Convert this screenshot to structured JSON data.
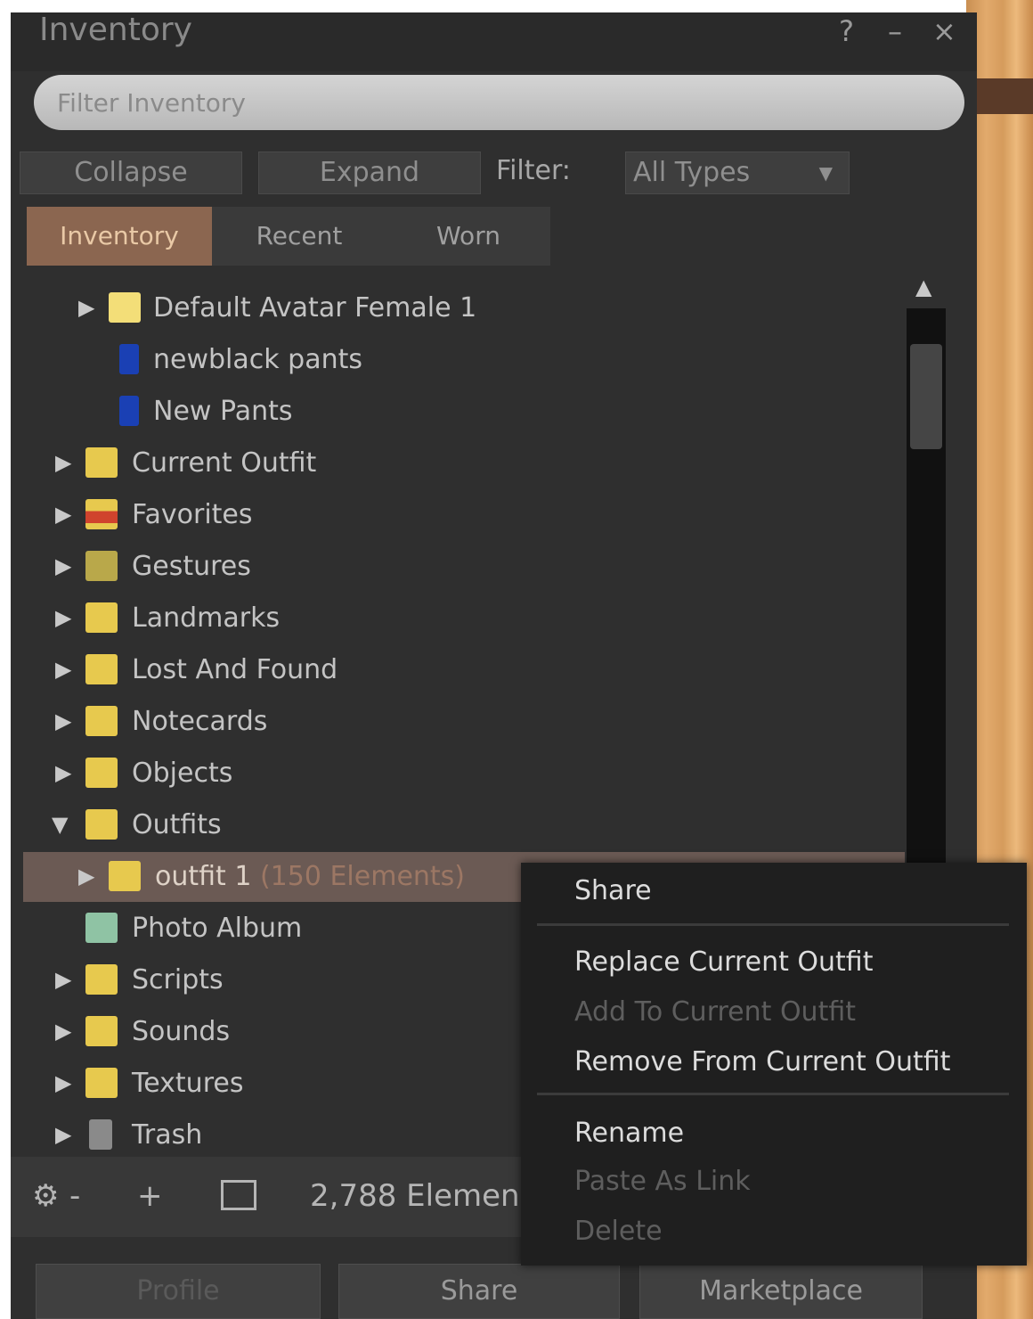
{
  "window": {
    "title": "Inventory",
    "controls": [
      "?",
      "–",
      "×"
    ]
  },
  "filter": {
    "placeholder": "Filter Inventory"
  },
  "toolbar": {
    "collapse_label": "Collapse",
    "expand_label": "Expand",
    "filter_label": "Filter:",
    "type_select": "All Types"
  },
  "tabs": [
    "Inventory",
    "Recent",
    "Worn"
  ],
  "tree": {
    "items": [
      {
        "label": "Default Avatar Female 1",
        "icon": "folder-icon",
        "expandable": true
      },
      {
        "label": "newblack pants",
        "icon": "pants-icon",
        "expandable": false
      },
      {
        "label": "New Pants",
        "icon": "pants-icon",
        "expandable": false
      },
      {
        "label": "Current Outfit",
        "icon": "outfit-folder-icon",
        "expandable": true
      },
      {
        "label": "Favorites",
        "icon": "favorites-folder-icon",
        "expandable": true
      },
      {
        "label": "Gestures",
        "icon": "gestures-folder-icon",
        "expandable": true
      },
      {
        "label": "Landmarks",
        "icon": "landmarks-folder-icon",
        "expandable": true
      },
      {
        "label": "Lost And Found",
        "icon": "lost-found-folder-icon",
        "expandable": true
      },
      {
        "label": "Notecards",
        "icon": "notecards-folder-icon",
        "expandable": true
      },
      {
        "label": "Objects",
        "icon": "objects-folder-icon",
        "expandable": true
      },
      {
        "label": "Outfits",
        "icon": "outfits-folder-icon",
        "expandable": true,
        "expanded": true
      },
      {
        "label": "outfit 1",
        "count": "(150 Elements)",
        "icon": "outfit-folder-icon",
        "expandable": true,
        "selected": true
      },
      {
        "label": "Photo Album",
        "icon": "photo-album-folder-icon",
        "expandable": false
      },
      {
        "label": "Scripts",
        "icon": "scripts-folder-icon",
        "expandable": true
      },
      {
        "label": "Sounds",
        "icon": "sounds-folder-icon",
        "expandable": true
      },
      {
        "label": "Textures",
        "icon": "textures-folder-icon",
        "expandable": true
      },
      {
        "label": "Trash",
        "icon": "trash-icon",
        "expandable": true
      }
    ]
  },
  "bottom_bar": {
    "gear": "⚙",
    "gear_menu": "-",
    "add": "+",
    "items_count": "2,788 Elemen"
  },
  "footer": {
    "profile_label": "Profile",
    "share_label": "Share",
    "marketplace_label": "Marketplace"
  },
  "context_menu": {
    "items": [
      {
        "label": "Share",
        "enabled": true
      },
      {
        "label": "Replace Current Outfit",
        "enabled": true
      },
      {
        "label": "Add To Current Outfit",
        "enabled": false
      },
      {
        "label": "Remove From Current Outfit",
        "enabled": true
      },
      {
        "label": "Rename",
        "enabled": true
      },
      {
        "label": "Paste As Link",
        "enabled": false
      },
      {
        "label": "Delete",
        "enabled": false
      }
    ]
  },
  "colors": {
    "panel": "#2f2f2f",
    "active_tab": "#8b6650",
    "selection": "#6b5a54",
    "menu": "#1f1f1f"
  }
}
